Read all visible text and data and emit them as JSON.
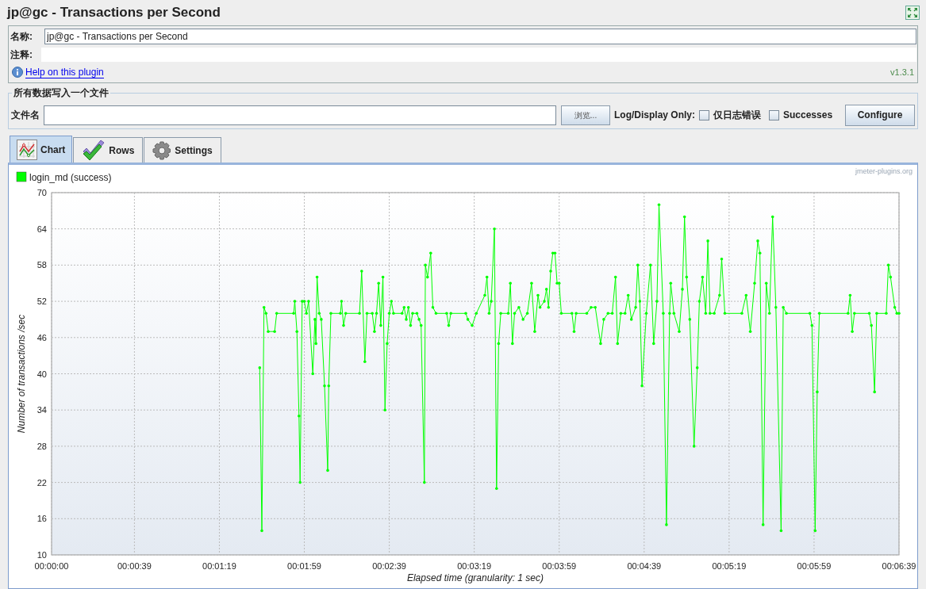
{
  "window": {
    "title": "jp@gc - Transactions per Second"
  },
  "name_field": {
    "label": "名称:",
    "value": "jp@gc - Transactions per Second"
  },
  "comment_field": {
    "label": "注释:"
  },
  "help_link": "Help on this plugin",
  "version": "v1.3.1",
  "file_group": {
    "title": "所有数据写入一个文件",
    "label": "文件名",
    "browse_button": "浏览...",
    "log_label": "Log/Display Only:",
    "checkboxes": [
      {
        "label": "仅日志错误",
        "checked": false
      },
      {
        "label": "Successes",
        "checked": false
      }
    ],
    "configure_button": "Configure"
  },
  "tabs": [
    {
      "label": "Chart",
      "kind": "chart",
      "selected": true
    },
    {
      "label": "Rows",
      "kind": "rows",
      "selected": false
    },
    {
      "label": "Settings",
      "kind": "settings",
      "selected": false
    }
  ],
  "watermark_text": "jmeter-plugins.org",
  "chart": {
    "chart_data": {
      "type": "line",
      "xlabel": "Elapsed time (granularity: 1 sec)",
      "ylabel": "Number of transactions /sec",
      "grid": true,
      "xlim": [
        0,
        399
      ],
      "ylim": [
        10,
        70
      ],
      "xticks": [
        {
          "value": 0,
          "label": "00:00:00"
        },
        {
          "value": 39,
          "label": "00:00:39"
        },
        {
          "value": 79,
          "label": "00:01:19"
        },
        {
          "value": 119,
          "label": "00:01:59"
        },
        {
          "value": 159,
          "label": "00:02:39"
        },
        {
          "value": 199,
          "label": "00:03:19"
        },
        {
          "value": 239,
          "label": "00:03:59"
        },
        {
          "value": 279,
          "label": "00:04:39"
        },
        {
          "value": 319,
          "label": "00:05:19"
        },
        {
          "value": 359,
          "label": "00:05:59"
        },
        {
          "value": 399,
          "label": "00:06:39"
        }
      ],
      "yticks": [
        10,
        16,
        22,
        28,
        34,
        40,
        46,
        52,
        58,
        64,
        70
      ],
      "x": [
        98,
        99,
        100,
        101,
        102,
        105,
        106,
        114,
        114.5,
        115.5,
        116.5,
        117,
        118,
        119,
        120,
        121,
        123,
        124,
        124.5,
        125,
        126,
        127,
        128.5,
        130,
        130.5,
        131.5,
        136,
        136.5,
        137.5,
        138.5,
        145,
        146,
        147.5,
        148.5,
        151,
        152,
        153,
        154,
        155,
        156,
        157,
        158,
        159,
        160,
        161,
        165,
        166,
        167,
        168,
        169,
        170,
        172,
        173,
        174,
        175.5,
        176,
        177,
        178.5,
        179.5,
        181,
        186,
        187,
        188,
        195,
        196,
        198,
        200,
        204,
        205,
        206,
        207,
        208.5,
        209.5,
        210.5,
        211.5,
        215,
        216,
        217,
        218,
        220,
        222,
        224,
        226,
        227.5,
        229,
        230,
        232,
        233,
        234,
        235,
        236,
        237,
        238,
        239,
        240,
        245,
        246,
        247,
        252,
        254,
        256,
        258.5,
        260,
        262,
        264,
        265.5,
        266.5,
        268,
        270,
        271.5,
        273,
        275,
        276,
        277,
        278,
        280,
        282,
        283.5,
        285,
        286,
        288,
        289.5,
        291,
        291.5,
        293,
        295.5,
        297,
        298,
        299,
        300.5,
        302.5,
        304,
        305,
        306.5,
        308,
        309,
        310,
        312,
        314.5,
        315.5,
        317,
        325,
        327,
        329,
        331,
        332.5,
        333.5,
        335,
        336.5,
        338,
        339.5,
        341,
        343.5,
        344.5,
        346,
        357,
        358,
        359.5,
        360.5,
        361.5,
        375,
        376,
        377,
        378,
        385,
        386,
        387.5,
        388.5,
        393,
        394,
        395,
        397,
        398,
        399
      ],
      "series": [
        {
          "name": "login_md (success)",
          "color": "#00ff00",
          "values": [
            41,
            14,
            51,
            50,
            47,
            47,
            50,
            50,
            52,
            47,
            33,
            22,
            52,
            52,
            50,
            52,
            40,
            49,
            45,
            56,
            50,
            49,
            38,
            24,
            38,
            50,
            50,
            52,
            48,
            50,
            50,
            57,
            42,
            50,
            50,
            47,
            50,
            55,
            48,
            56,
            34,
            45,
            50,
            52,
            50,
            50,
            51,
            49,
            51,
            48,
            50,
            50,
            49,
            48,
            22,
            58,
            56,
            60,
            51,
            50,
            50,
            48,
            50,
            50,
            49,
            48,
            50,
            53,
            56,
            50,
            52,
            64,
            21,
            45,
            50,
            50,
            55,
            45,
            50,
            51,
            49,
            50,
            55,
            47,
            53,
            51,
            52,
            54,
            51,
            57,
            60,
            60,
            55,
            55,
            50,
            50,
            47,
            50,
            50,
            51,
            51,
            45,
            49,
            50,
            50,
            56,
            45,
            50,
            50,
            53,
            49,
            51,
            58,
            52,
            38,
            50,
            58,
            45,
            52,
            68,
            50,
            15,
            50,
            55,
            50,
            47,
            54,
            66,
            56,
            49,
            28,
            41,
            52,
            56,
            50,
            62,
            50,
            50,
            53,
            59,
            50,
            50,
            53,
            47,
            55,
            62,
            60,
            15,
            55,
            50,
            66,
            51,
            14,
            51,
            50,
            50,
            48,
            14,
            37,
            50,
            50,
            53,
            47,
            50,
            50,
            48,
            37,
            50,
            50,
            58,
            56,
            51,
            50,
            50
          ]
        }
      ]
    }
  }
}
